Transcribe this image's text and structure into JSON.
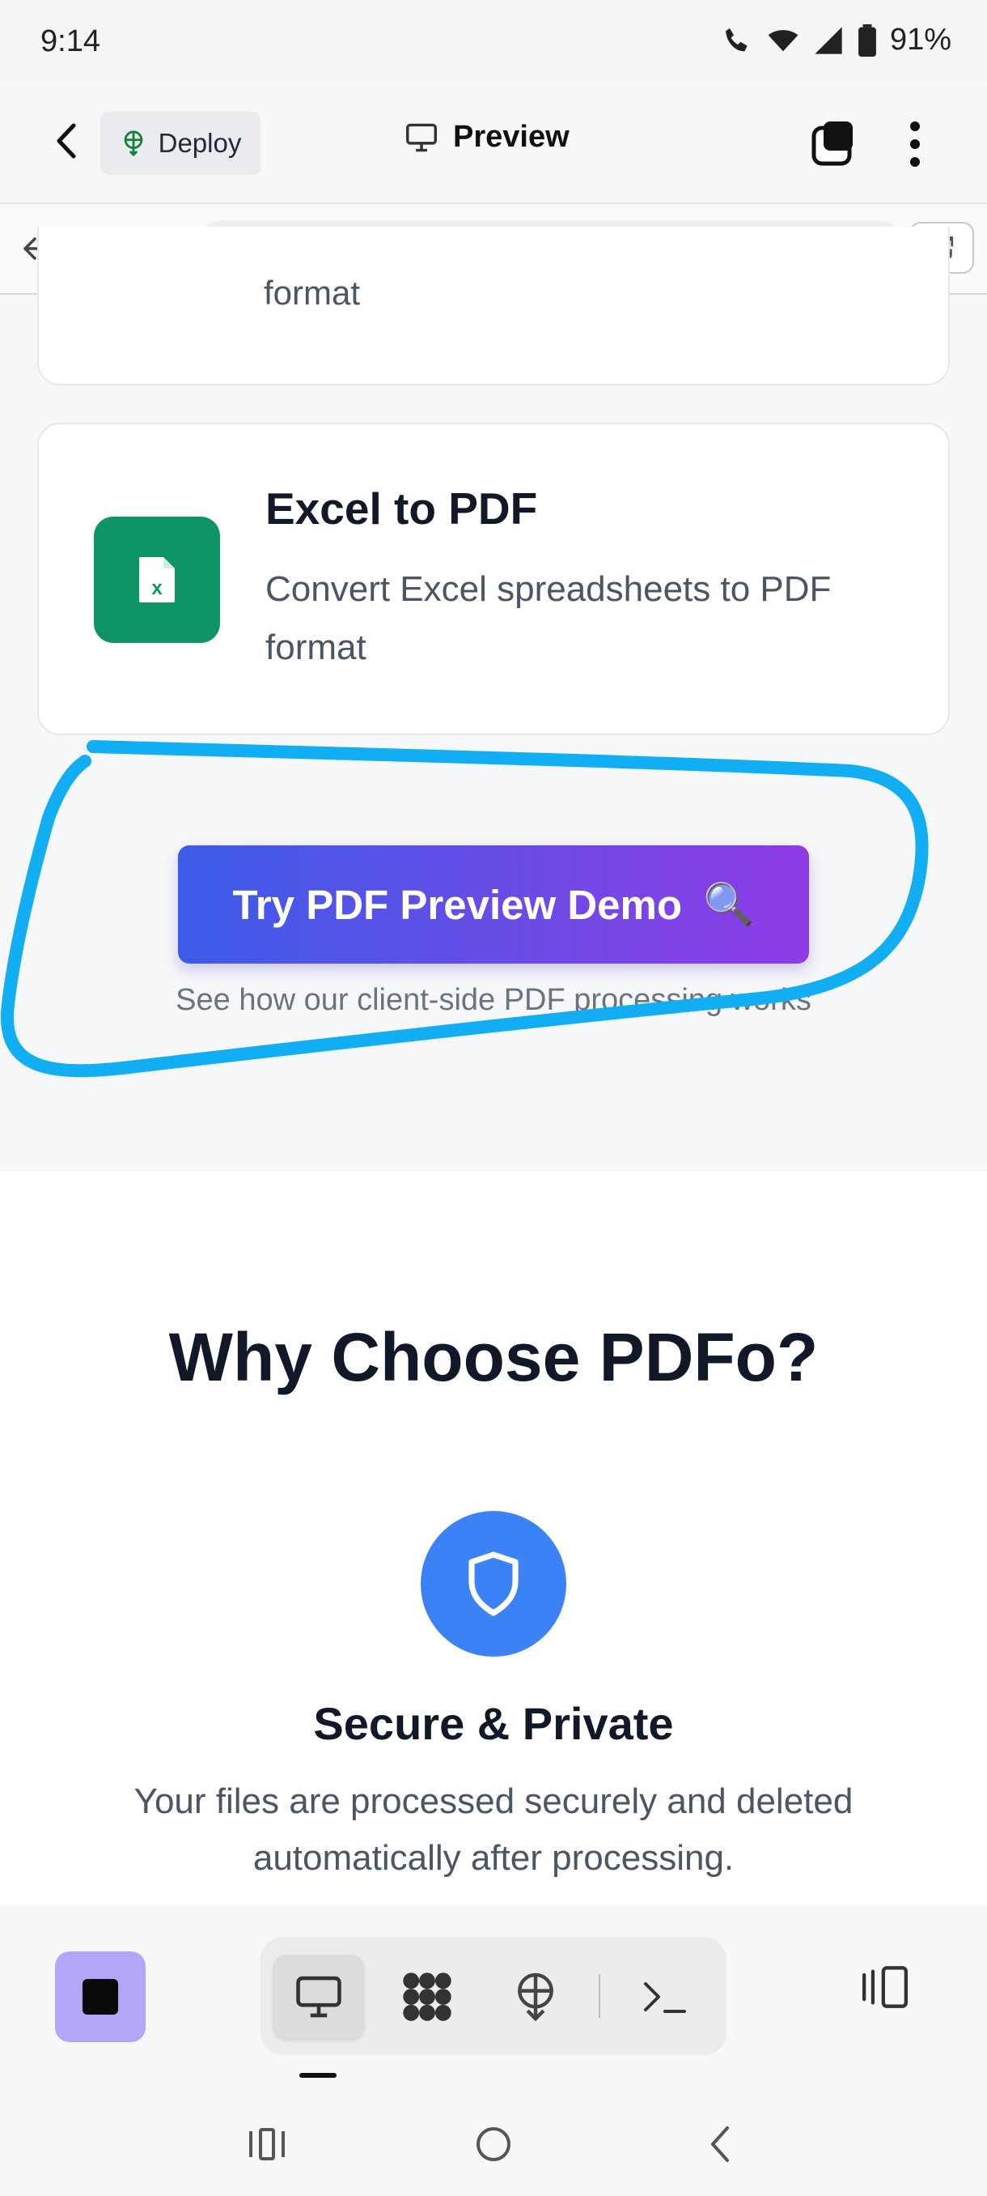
{
  "status_bar": {
    "time": "9:14",
    "battery": "91%"
  },
  "header": {
    "deploy_label": "Deploy",
    "title": "Preview"
  },
  "url_bar": {
    "url": "/"
  },
  "cards": {
    "previous_desc_tail": "format",
    "excel": {
      "title": "Excel to PDF",
      "description": "Convert Excel spreadsheets to PDF format",
      "icon_letter": "x"
    }
  },
  "demo": {
    "button_label": "Try PDF Preview Demo",
    "button_emoji": "🔍",
    "subtitle": "See how our client-side PDF processing works"
  },
  "why": {
    "title": "Why Choose PDFo?",
    "feature": {
      "title": "Secure & Private",
      "description": "Your files are processed securely and deleted automatically after processing."
    }
  },
  "colors": {
    "excel_green": "#0e9466",
    "feature_blue": "#3b82f6",
    "gradient_start": "#3b5ce8",
    "gradient_end": "#8e3be6",
    "annotation": "#12aef3",
    "stop_button": "#b4a6f6"
  }
}
